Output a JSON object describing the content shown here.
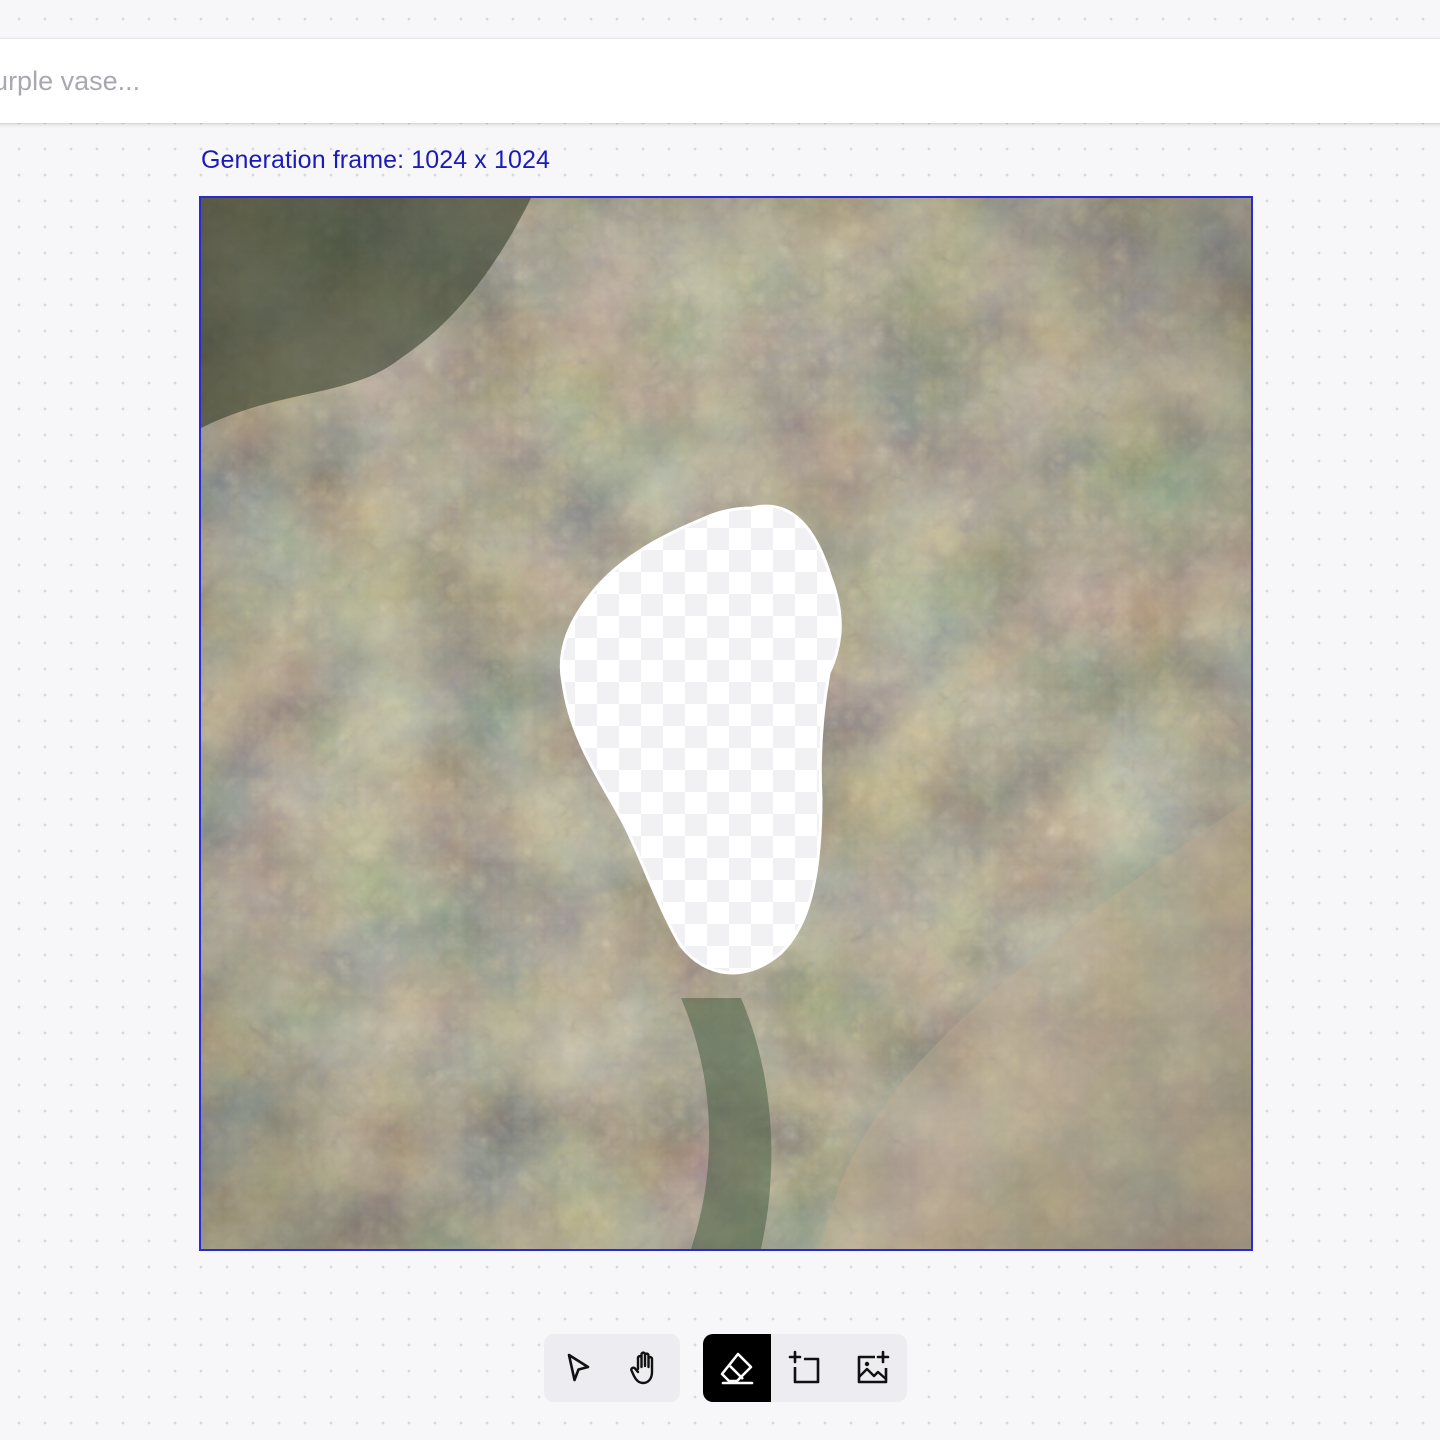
{
  "prompt": {
    "placeholder": "s in a purple vase..."
  },
  "canvas": {
    "frame_label": "Generation frame: 1024 x 1024",
    "accent_color": "#1b1bb8",
    "frame_border_color": "#2a2ad4",
    "erased_region": "transparent checkerboard"
  },
  "toolbar": {
    "navigation_tools": [
      {
        "id": "select",
        "icon": "cursor-arrow-icon",
        "active": false
      },
      {
        "id": "pan",
        "icon": "hand-icon",
        "active": false
      }
    ],
    "edit_tools": [
      {
        "id": "eraser",
        "icon": "eraser-icon",
        "active": true
      },
      {
        "id": "add-frame",
        "icon": "add-frame-icon",
        "active": false
      },
      {
        "id": "upload-image",
        "icon": "image-add-icon",
        "active": false
      }
    ]
  }
}
